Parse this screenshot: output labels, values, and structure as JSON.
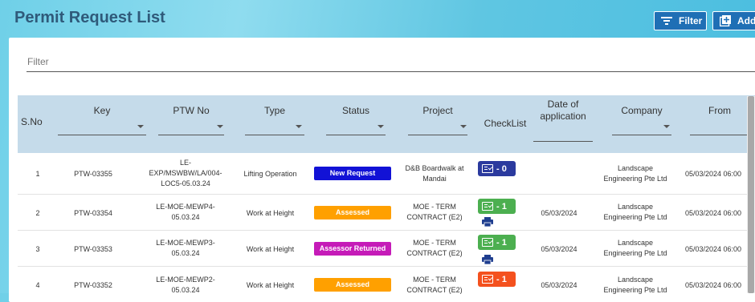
{
  "page": {
    "title": "Permit Request List"
  },
  "toolbar": {
    "filter_label": "Filter",
    "add_label": "Add"
  },
  "search": {
    "placeholder": "Filter"
  },
  "table": {
    "headers": {
      "sno": "S.No",
      "key": "Key",
      "ptw": "PTW No",
      "type": "Type",
      "status": "Status",
      "project": "Project",
      "checklist": "CheckList",
      "date1": "Date of",
      "date2": "application",
      "company": "Company",
      "from": "From"
    },
    "rows": [
      {
        "sno": "1",
        "key": "PTW-03355",
        "ptw": [
          "LE-",
          "EXP/MSWBW/LA/004-",
          "LOC5-05.03.24"
        ],
        "type": "Lifting Operation",
        "status": "New Request",
        "status_color": "#1212d6",
        "project": [
          "D&B Boardwalk at",
          "Mandai"
        ],
        "checklist": "- 0",
        "checklist_color": "#2b3a9e",
        "print": false,
        "date": "",
        "company": [
          "Landscape",
          "Engineering Pte Ltd"
        ],
        "from": "05/03/2024 06:00"
      },
      {
        "sno": "2",
        "key": "PTW-03354",
        "ptw": [
          "LE-MOE-MEWP4-",
          "05.03.24"
        ],
        "type": "Work at Height",
        "status": "Assessed",
        "status_color": "#ffa000",
        "project": [
          "MOE - TERM",
          "CONTRACT (E2)"
        ],
        "checklist": "- 1",
        "checklist_color": "#4caf50",
        "print": true,
        "date": "05/03/2024",
        "company": [
          "Landscape",
          "Engineering Pte Ltd"
        ],
        "from": "05/03/2024 06:00"
      },
      {
        "sno": "3",
        "key": "PTW-03353",
        "ptw": [
          "LE-MOE-MEWP3-",
          "05.03.24"
        ],
        "type": "Work at Height",
        "status": "Assessor Returned",
        "status_color": "#c51bb8",
        "project": [
          "MOE - TERM",
          "CONTRACT (E2)"
        ],
        "checklist": "- 1",
        "checklist_color": "#4caf50",
        "print": true,
        "date": "05/03/2024",
        "company": [
          "Landscape",
          "Engineering Pte Ltd"
        ],
        "from": "05/03/2024 06:00"
      },
      {
        "sno": "4",
        "key": "PTW-03352",
        "ptw": [
          "LE-MOE-MEWP2-",
          "05.03.24"
        ],
        "type": "Work at Height",
        "status": "Assessed",
        "status_color": "#ffa000",
        "project": [
          "MOE - TERM",
          "CONTRACT (E2)"
        ],
        "checklist": "- 1",
        "checklist_color": "#f4511e",
        "print": false,
        "date": "05/03/2024",
        "company": [
          "Landscape",
          "Engineering Pte Ltd"
        ],
        "from": "05/03/2024 06:00"
      }
    ]
  }
}
